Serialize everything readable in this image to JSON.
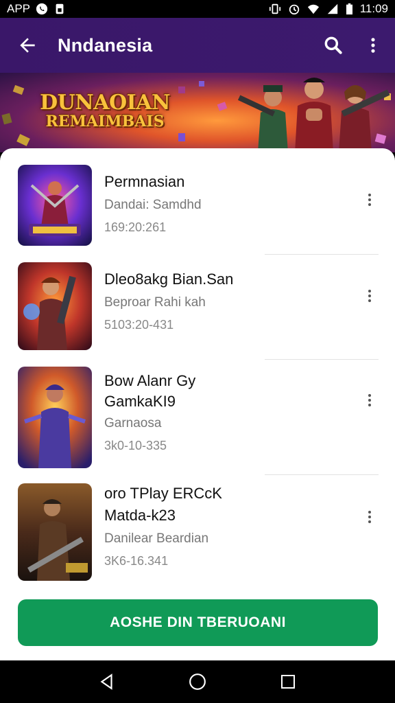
{
  "status_bar": {
    "app_label": "APP",
    "time": "11:09",
    "icons": [
      "whatsapp-icon",
      "sim-icon",
      "vibrate-icon",
      "alarm-icon",
      "wifi-icon",
      "signal-icon",
      "battery-icon"
    ]
  },
  "app_bar": {
    "title": "Nndanesia",
    "icons": [
      "back-arrow-icon",
      "search-icon",
      "more-vert-icon"
    ]
  },
  "banner": {
    "title_line1": "DUNAOIAN",
    "title_line2": "REMAIMBAIS"
  },
  "items": [
    {
      "title": "Permnasian",
      "subtitle": "Dandai: Samdhd",
      "meta": "169:20:261"
    },
    {
      "title": "Dleo8akg Bian.San",
      "subtitle": "Beproar Rahi kah",
      "meta": "5103:20-431"
    },
    {
      "title_line1": "Bow Alanr Gy",
      "title_line2": "GamkaKI9",
      "subtitle": "Garnaosa",
      "meta": "3k0-10-335"
    },
    {
      "title_line1": "oro TPlay ERCcK",
      "title_line2": "Matda-k23",
      "subtitle": "Danilear Beardian",
      "meta": "3K6-16.341"
    }
  ],
  "install_button": {
    "label": "AOSHE DIN TBERUOANI"
  },
  "colors": {
    "app_bar": "#3a1769",
    "button": "#109a57",
    "title_gold": "#f9c23c"
  }
}
